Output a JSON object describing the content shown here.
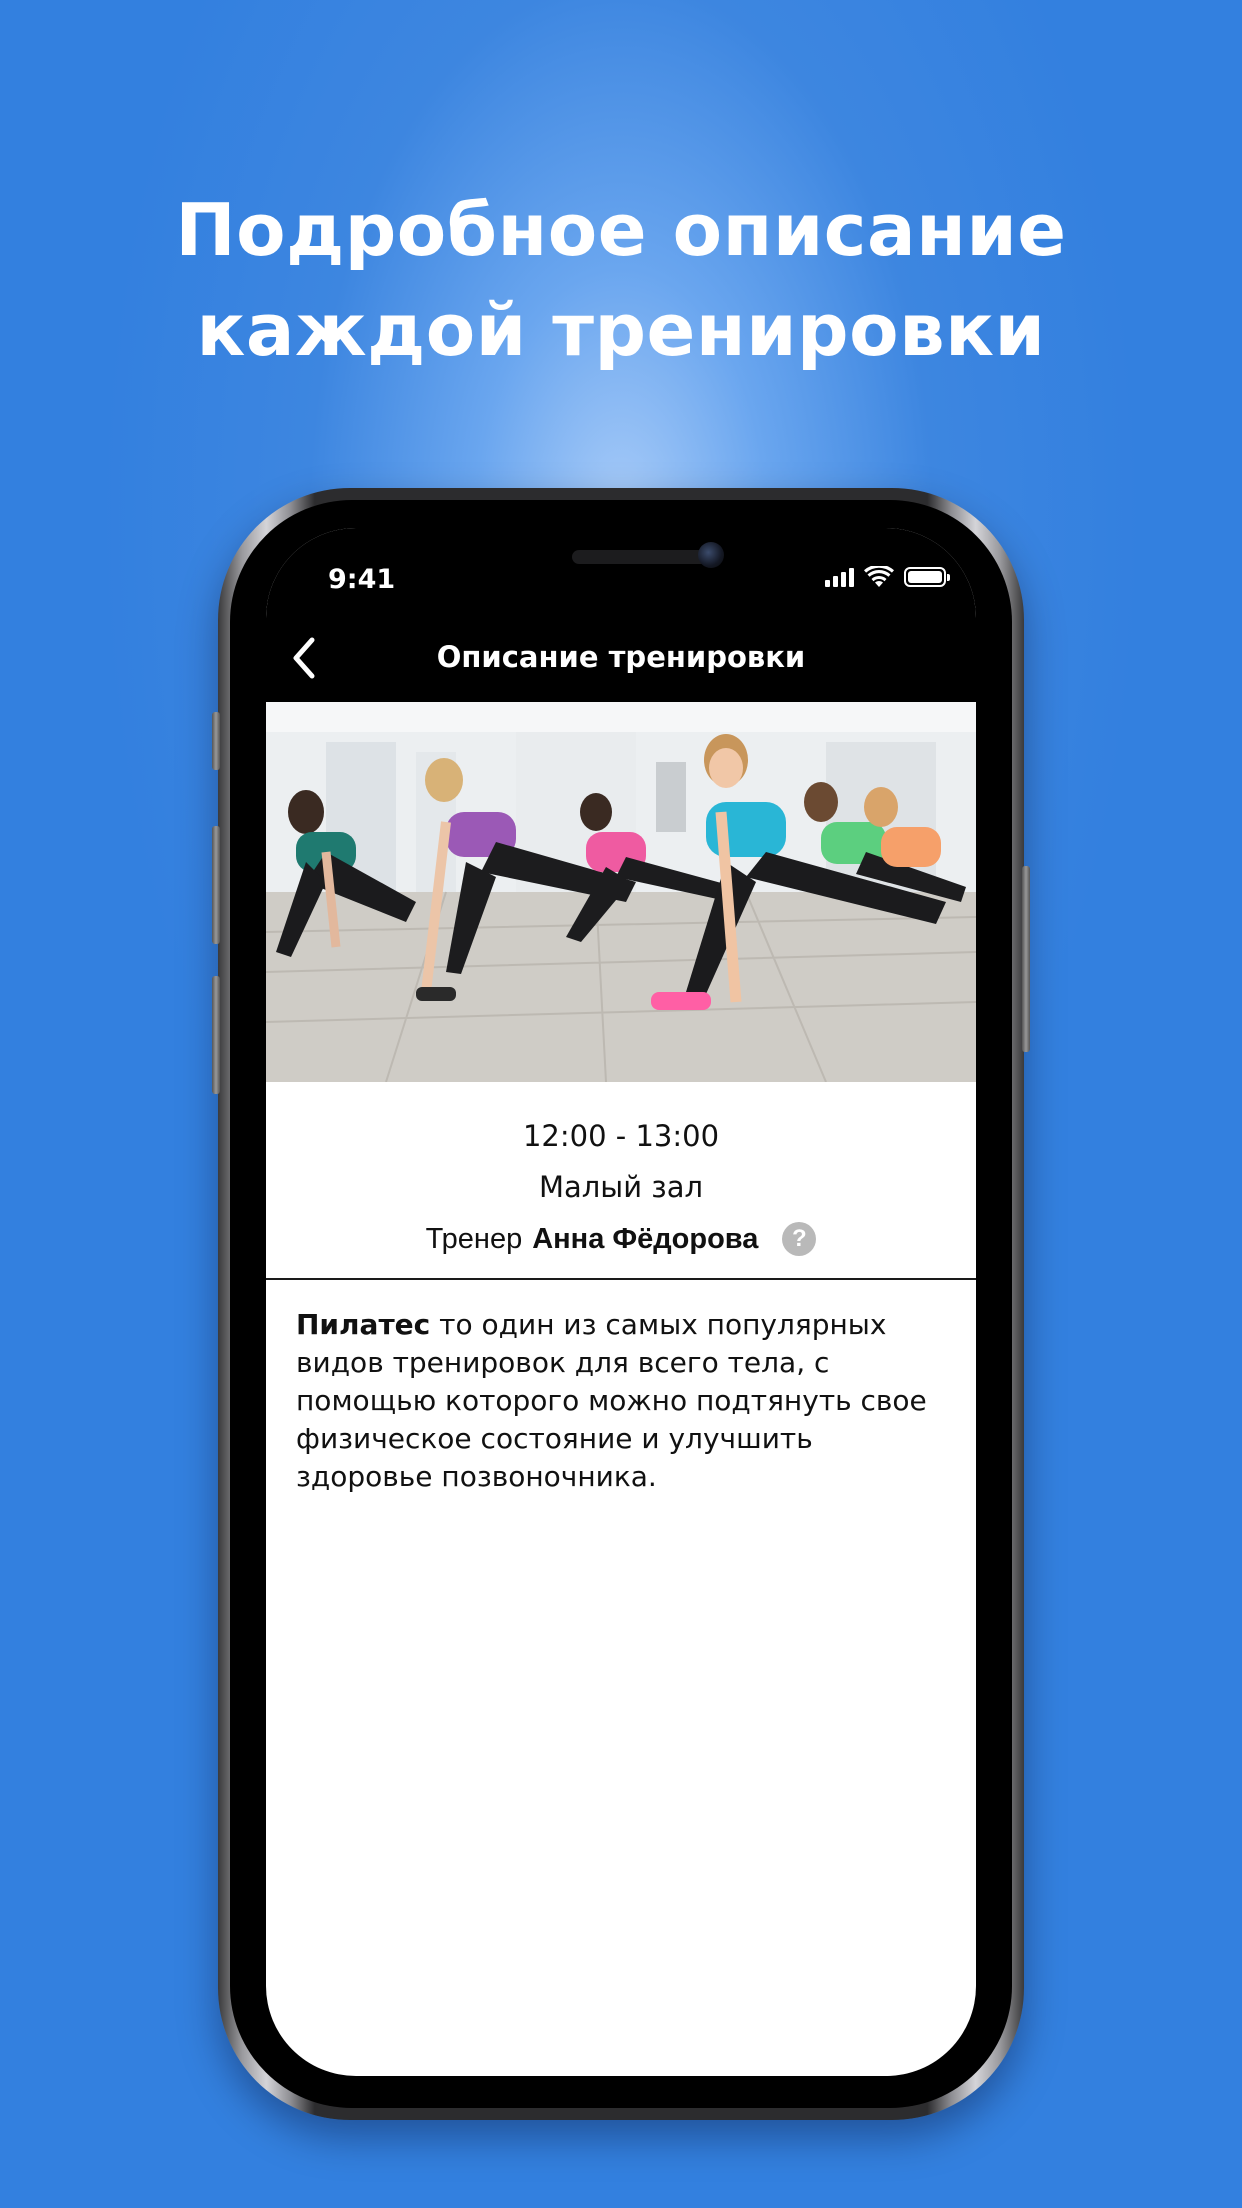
{
  "promo": {
    "headline_line1": "Подробное описание",
    "headline_line2": "каждой тренировки"
  },
  "status_bar": {
    "time": "9:41",
    "icons": [
      "cellular-signal-icon",
      "wifi-icon",
      "battery-icon"
    ]
  },
  "nav": {
    "back_icon": "chevron-left-icon",
    "title": "Описание тренировки"
  },
  "workout": {
    "time_range": "12:00 - 13:00",
    "hall": "Малый зал",
    "trainer_label": "Тренер",
    "trainer_name": "Анна Фёдорова",
    "help_icon": "question-circle-icon",
    "help_glyph": "?",
    "title": "Пилатес",
    "description": " то один из самых популярных видов тренировок для всего тела, с помощью  которого можно подтянуть свое физическое состояние и улучшить здоровье позвоночника."
  },
  "colors": {
    "background": "#3380df",
    "nav_bar": "#000000",
    "text": "#111111",
    "help_icon": "#b9b9b9"
  }
}
